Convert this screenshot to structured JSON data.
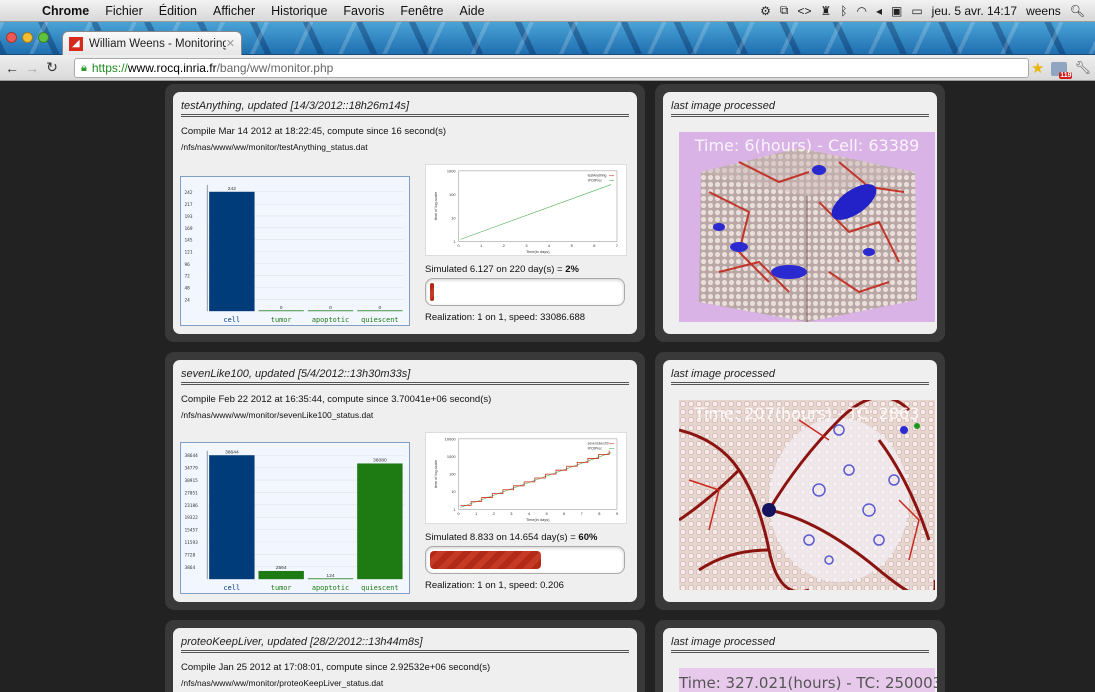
{
  "menubar": {
    "app": "Chrome",
    "items": [
      "Fichier",
      "Édition",
      "Afficher",
      "Historique",
      "Favoris",
      "Fenêtre",
      "Aide"
    ],
    "clock": "jeu. 5 avr. 14:17",
    "user": "weens"
  },
  "tab": {
    "title": "William Weens - Monitoring"
  },
  "url": {
    "scheme": "https://",
    "host": "www.rocq.inria.fr",
    "path": "/bang/ww/monitor.php"
  },
  "ext_badge": "119",
  "panels": [
    {
      "title": "testAnything, updated [14/3/2012::18h26m14s]",
      "compile": "Compile Mar 14 2012 at 18:22:45, compute since 16 second(s)",
      "path": "/nfs/nas/www/ww/monitor/testAnything_status.dat",
      "sim_prefix": "Simulated 6.127 on 220 day(s) = ",
      "sim_pct": "2%",
      "progress": 0.02,
      "realization": "Realization: 1 on 1, speed: 33086.688",
      "image_title": "last image processed",
      "image_caption": "Time: 6(hours) - Cell: 63389"
    },
    {
      "title": "sevenLike100, updated [5/4/2012::13h30m33s]",
      "compile": "Compile Feb 22 2012 at 16:35:44, compute since 3.70041e+06 second(s)",
      "path": "/nfs/nas/www/ww/monitor/sevenLike100_status.dat",
      "sim_prefix": "Simulated 8.833 on 14.654 day(s) = ",
      "sim_pct": "60%",
      "progress": 0.6,
      "realization": "Realization: 1 on 1, speed: 0.206",
      "image_title": "last image processed",
      "image_caption": "Time: 207(hours) - TC: 2863"
    },
    {
      "title": "proteoKeepLiver, updated [28/2/2012::13h44m8s]",
      "compile": "Compile Jan 25 2012 at 17:08:01, compute since 2.92532e+06 second(s)",
      "path": "/nfs/nas/www/ww/monitor/proteoKeepLiver_status.dat",
      "image_title": "last image processed",
      "image_caption": "Time: 327.021(hours) - TC: 250003"
    }
  ],
  "colors": {
    "cell": "#003b7a",
    "other": "#1e7a12",
    "progress": "#b12a17"
  },
  "chart_data": [
    {
      "type": "bar",
      "categories": [
        "cell",
        "tumor",
        "apoptotic",
        "quiescent"
      ],
      "values": [
        242,
        0,
        0,
        0
      ],
      "ylim": [
        0,
        256
      ],
      "yticks": [
        242,
        217,
        193,
        169,
        145,
        121,
        96,
        72,
        48,
        24
      ],
      "colors": [
        "#003b7a",
        "#1e7a12",
        "#1e7a12",
        "#1e7a12"
      ]
    },
    {
      "type": "line",
      "legend": [
        "testAnything",
        "IPCitPrec"
      ],
      "xticks": [
        "0",
        "1",
        "2",
        "3",
        "4",
        "5",
        "6",
        "7"
      ],
      "yticks": [
        "1000",
        "100",
        "10",
        "1"
      ],
      "xlabel": "Time(in days)",
      "ylabel": "time of log-scale",
      "steps": false
    },
    {
      "type": "bar",
      "categories": [
        "cell",
        "tumor",
        "apoptotic",
        "quiescent"
      ],
      "values": [
        38644,
        2564,
        124,
        36080
      ],
      "ylim": [
        0,
        40000
      ],
      "yticks": [
        38644,
        34779,
        30915,
        27051,
        23186,
        19322,
        15457,
        11593,
        7728,
        3864
      ],
      "colors": [
        "#003b7a",
        "#1e7a12",
        "#1e7a12",
        "#1e7a12"
      ]
    },
    {
      "type": "line",
      "legend": [
        "sevenLike100",
        "IPCitPrec"
      ],
      "xticks": [
        "0",
        "1",
        "2",
        "3",
        "4",
        "5",
        "6",
        "7",
        "8",
        "9"
      ],
      "yticks": [
        "10000",
        "1000",
        "100",
        "10",
        "1"
      ],
      "xlabel": "Time(in days)",
      "ylabel": "time of log-scale",
      "steps": true
    }
  ]
}
